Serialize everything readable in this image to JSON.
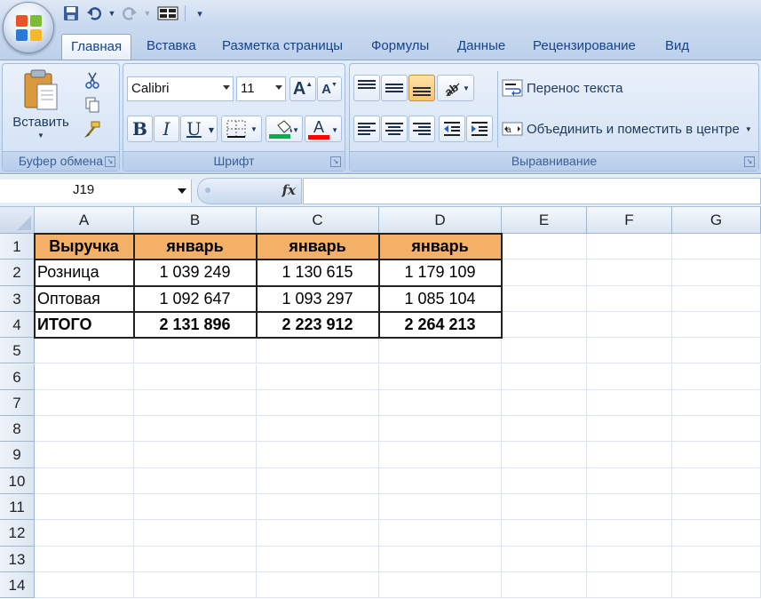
{
  "qat": {
    "icons": [
      "save-icon",
      "undo-icon",
      "redo-icon",
      "layout-icon",
      "customize-icon"
    ]
  },
  "tabs": [
    {
      "label": "Главная",
      "active": true
    },
    {
      "label": "Вставка"
    },
    {
      "label": "Разметка страницы"
    },
    {
      "label": "Формулы"
    },
    {
      "label": "Данные"
    },
    {
      "label": "Рецензирование"
    },
    {
      "label": "Вид"
    }
  ],
  "clipboard": {
    "paste_label": "Вставить",
    "group_label": "Буфер обмена"
  },
  "font": {
    "family": "Calibri",
    "size": "11",
    "bold_label": "B",
    "italic_label": "I",
    "underline_label": "U",
    "grow_label": "A",
    "shrink_label": "A",
    "color_label": "A",
    "group_label": "Шрифт",
    "fill_color": "#00b050",
    "font_color": "#ff0000"
  },
  "alignment": {
    "wrap_label": "Перенос текста",
    "merge_label": "Объединить и поместить в центре",
    "group_label": "Выравнивание"
  },
  "formula_bar": {
    "name_box": "J19",
    "fx_label": "fx",
    "content": ""
  },
  "sheet": {
    "columns": [
      "A",
      "B",
      "C",
      "D",
      "E",
      "F",
      "G"
    ],
    "rows": [
      "1",
      "2",
      "3",
      "4",
      "5",
      "6",
      "7",
      "8",
      "9",
      "10",
      "11",
      "12",
      "13",
      "14"
    ],
    "data": [
      [
        "Выручка",
        "январь",
        "январь",
        "январь"
      ],
      [
        "Розница",
        "1 039 249",
        "1 130 615",
        "1 179 109"
      ],
      [
        "Оптовая",
        "1 092 647",
        "1 093 297",
        "1 085 104"
      ],
      [
        "ИТОГО",
        "2 131 896",
        "2 223 912",
        "2 264 213"
      ]
    ],
    "header_color": "#f4b066"
  }
}
